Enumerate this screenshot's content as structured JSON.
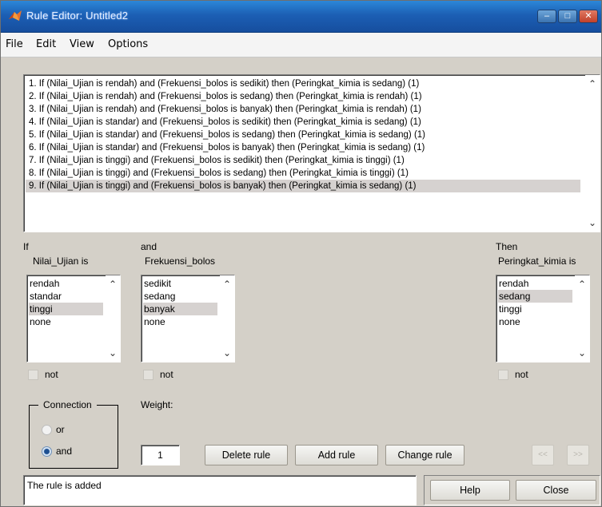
{
  "window": {
    "title": "Rule Editor: Untitled2"
  },
  "menu": [
    "File",
    "Edit",
    "View",
    "Options"
  ],
  "rules": [
    "1. If (Nilai_Ujian is rendah) and (Frekuensi_bolos is sedikit) then (Peringkat_kimia is sedang) (1)",
    "2. If (Nilai_Ujian is rendah) and (Frekuensi_bolos is sedang) then (Peringkat_kimia is rendah) (1)",
    "3. If (Nilai_Ujian is rendah) and (Frekuensi_bolos is banyak) then (Peringkat_kimia is rendah) (1)",
    "4. If (Nilai_Ujian is standar) and (Frekuensi_bolos is sedikit) then (Peringkat_kimia is sedang) (1)",
    "5. If (Nilai_Ujian is standar) and (Frekuensi_bolos is sedang) then (Peringkat_kimia is sedang) (1)",
    "6. If (Nilai_Ujian is standar) and (Frekuensi_bolos is banyak) then (Peringkat_kimia is sedang) (1)",
    "7. If (Nilai_Ujian is tinggi) and (Frekuensi_bolos is sedikit) then (Peringkat_kimia is tinggi) (1)",
    "8. If (Nilai_Ujian is tinggi) and (Frekuensi_bolos is sedang) then (Peringkat_kimia is tinggi) (1)",
    "9. If (Nilai_Ujian is tinggi) and (Frekuensi_bolos is banyak) then (Peringkat_kimia is sedang) (1)"
  ],
  "selected_rule": 9,
  "if_col": {
    "header": "If",
    "variable": "Nilai_Ujian is",
    "options": [
      "rendah",
      "standar",
      "tinggi",
      "none"
    ],
    "selected": "tinggi",
    "not_label": "not"
  },
  "and_col": {
    "header": "and",
    "variable": "Frekuensi_bolos",
    "options": [
      "sedikit",
      "sedang",
      "banyak",
      "none"
    ],
    "selected": "banyak",
    "not_label": "not"
  },
  "then_col": {
    "header": "Then",
    "variable": "Peringkat_kimia is",
    "options": [
      "rendah",
      "sedang",
      "tinggi",
      "none"
    ],
    "selected": "sedang",
    "not_label": "not"
  },
  "connection": {
    "label": "Connection",
    "or": "or",
    "and": "and",
    "selected": "and"
  },
  "weight": {
    "label": "Weight:",
    "value": "1"
  },
  "buttons": {
    "delete": "Delete rule",
    "add": "Add rule",
    "change": "Change rule",
    "prev": "<<",
    "next": ">>",
    "help": "Help",
    "close": "Close"
  },
  "status": "The rule is added",
  "colors": {
    "title_bar": "#1c5fb4",
    "selection": "#d6d2d0",
    "radio_selected": "#1d4f91"
  }
}
